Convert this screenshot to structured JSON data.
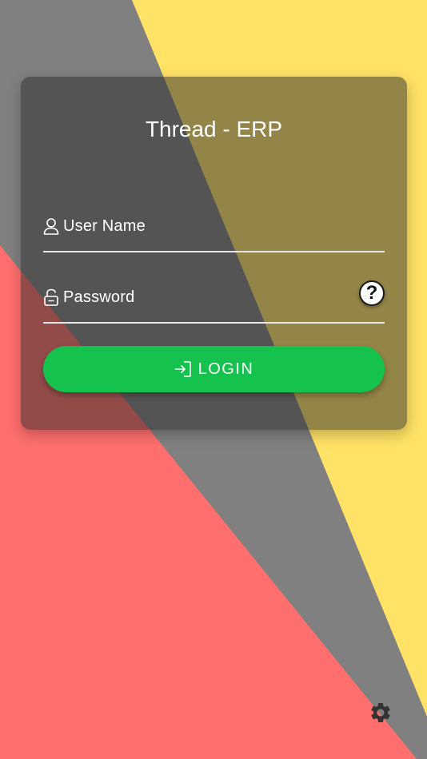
{
  "app": {
    "title": "Thread - ERP"
  },
  "form": {
    "username": {
      "label": "User Name",
      "icon": "user-icon"
    },
    "password": {
      "label": "Password",
      "icon": "unlock-icon",
      "help_label": "?"
    },
    "login": {
      "label": "LOGIN",
      "icon": "login-icon"
    }
  },
  "settings": {
    "icon": "gear-icon"
  },
  "colors": {
    "background_gray": "#808080",
    "yellow": "#ffe266",
    "red": "#ff6f6d",
    "login_green": "#15c24e"
  }
}
